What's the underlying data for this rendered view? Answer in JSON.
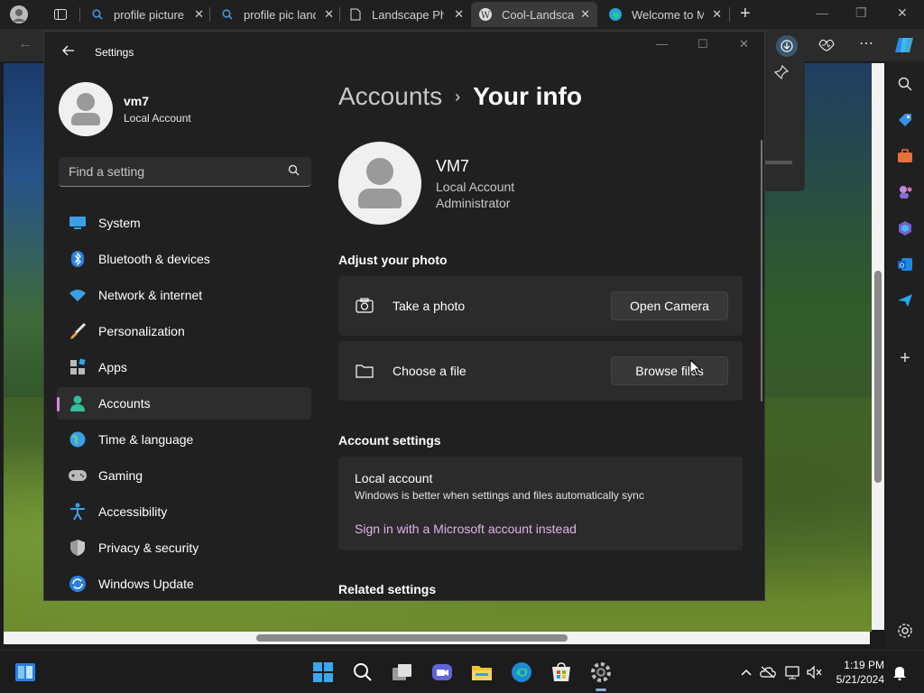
{
  "browser": {
    "tabs": [
      {
        "label": "profile picture",
        "icon": "search-icon"
      },
      {
        "label": "profile pic landscape",
        "icon": "search-icon"
      },
      {
        "label": "Landscape Photo",
        "icon": "document-icon"
      },
      {
        "label": "Cool-Landscape",
        "icon": "wordpress-icon"
      },
      {
        "label": "Welcome to Microsoft",
        "icon": "edge-icon"
      }
    ],
    "close_glyph": "✕",
    "new_tab_glyph": "+"
  },
  "settings": {
    "window_title": "Settings",
    "profile": {
      "name": "vm7",
      "type": "Local Account"
    },
    "search_placeholder": "Find a setting",
    "nav": [
      {
        "label": "System",
        "icon": "system-icon"
      },
      {
        "label": "Bluetooth & devices",
        "icon": "bluetooth-icon"
      },
      {
        "label": "Network & internet",
        "icon": "wifi-icon"
      },
      {
        "label": "Personalization",
        "icon": "brush-icon"
      },
      {
        "label": "Apps",
        "icon": "apps-icon"
      },
      {
        "label": "Accounts",
        "icon": "accounts-icon",
        "selected": true
      },
      {
        "label": "Time & language",
        "icon": "globe-icon"
      },
      {
        "label": "Gaming",
        "icon": "gamepad-icon"
      },
      {
        "label": "Accessibility",
        "icon": "accessibility-icon"
      },
      {
        "label": "Privacy & security",
        "icon": "shield-icon"
      },
      {
        "label": "Windows Update",
        "icon": "update-icon"
      }
    ],
    "breadcrumb": {
      "parent": "Accounts",
      "separator": "›",
      "current": "Your info"
    },
    "user": {
      "name": "VM7",
      "line1": "Local Account",
      "line2": "Administrator"
    },
    "adjust_heading": "Adjust your photo",
    "take_photo": {
      "label": "Take a photo",
      "button": "Open Camera"
    },
    "choose_file": {
      "label": "Choose a file",
      "button": "Browse files"
    },
    "account_settings_heading": "Account settings",
    "account": {
      "title": "Local account",
      "desc": "Windows is better when settings and files automatically sync",
      "link": "Sign in with a Microsoft account instead"
    },
    "related_heading": "Related settings"
  },
  "taskbar": {
    "time": "1:19 PM",
    "date": "5/21/2024"
  },
  "colors": {
    "accent": "#d38be0",
    "link": "#e2b0ee"
  }
}
